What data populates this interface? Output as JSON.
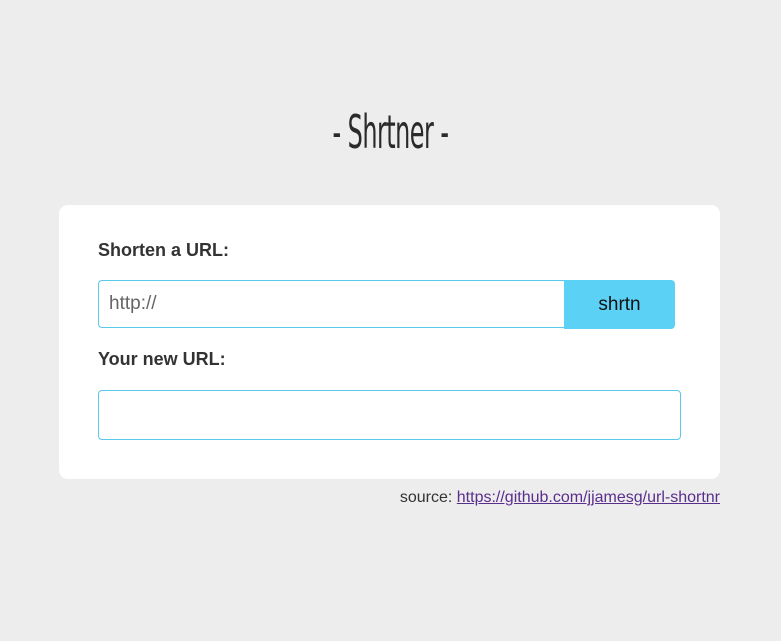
{
  "header": {
    "title": "- Shrtner -"
  },
  "form": {
    "shorten_label": "Shorten a URL:",
    "url_placeholder": "http://",
    "submit_label": "shrtn",
    "result_label": "Your new URL:",
    "result_value": ""
  },
  "footer": {
    "source_prefix": "source:",
    "source_link": "https://github.com/jjamesg/url-shortnr"
  },
  "colors": {
    "background": "#ededed",
    "card": "#ffffff",
    "accent": "#5bd1f6",
    "input_border": "#5bc8ed",
    "link": "#5a2e8c"
  }
}
